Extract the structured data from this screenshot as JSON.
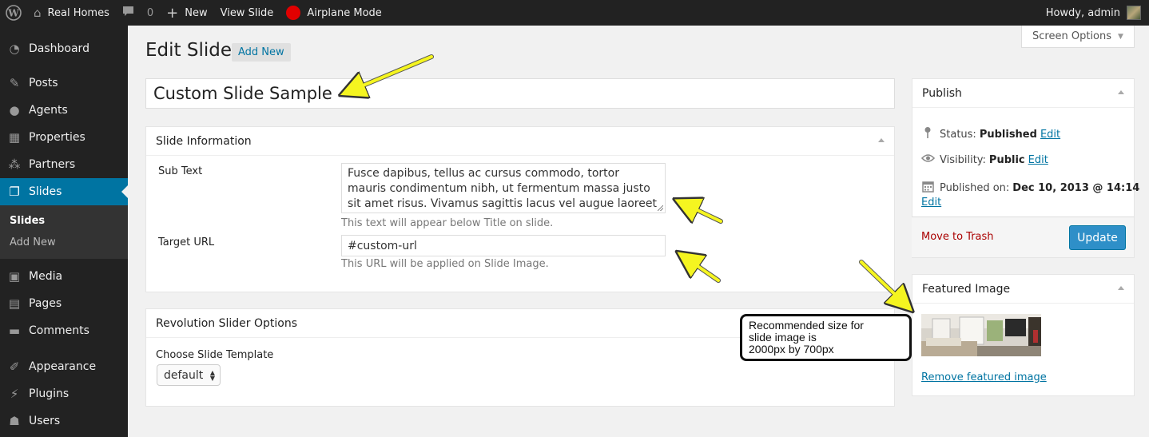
{
  "admin_bar": {
    "site_name": "Real Homes",
    "comments_count": "0",
    "new_label": "New",
    "view_label": "View Slide",
    "airplane_label": "Airplane Mode",
    "greeting": "Howdy, admin"
  },
  "sidebar": {
    "items": [
      {
        "label": "Dashboard",
        "icon": "dashboard-icon"
      },
      {
        "label": "Posts",
        "icon": "pin-icon"
      },
      {
        "label": "Agents",
        "icon": "users-icon"
      },
      {
        "label": "Properties",
        "icon": "building-icon"
      },
      {
        "label": "Partners",
        "icon": "groups-icon"
      },
      {
        "label": "Slides",
        "icon": "slides-icon"
      },
      {
        "label": "Media",
        "icon": "media-icon"
      },
      {
        "label": "Pages",
        "icon": "page-icon"
      },
      {
        "label": "Comments",
        "icon": "comment-icon"
      },
      {
        "label": "Appearance",
        "icon": "brush-icon"
      },
      {
        "label": "Plugins",
        "icon": "plug-icon"
      },
      {
        "label": "Users",
        "icon": "user-icon"
      }
    ],
    "submenu": [
      "Slides",
      "Add New"
    ],
    "accent": "#0074a2"
  },
  "header": {
    "screen_options": "Screen Options",
    "page_title": "Edit Slide",
    "add_new": "Add New"
  },
  "post": {
    "title": "Custom Slide Sample"
  },
  "slide_info": {
    "heading": "Slide Information",
    "sub_text_label": "Sub Text",
    "sub_text_value": "Fusce dapibus, tellus ac cursus commodo, tortor mauris condimentum nibh, ut fermentum massa justo sit amet risus. Vivamus sagittis lacus vel augue laoreet rutrum",
    "sub_text_desc": "This text will appear below Title on slide.",
    "url_label": "Target URL",
    "url_value": "#custom-url",
    "url_desc": "This URL will be applied on Slide Image."
  },
  "revolution": {
    "heading": "Revolution Slider Options",
    "template_label": "Choose Slide Template",
    "template_value": "default"
  },
  "publish": {
    "heading": "Publish",
    "status_label": "Status:",
    "status_value": "Published",
    "visibility_label": "Visibility:",
    "visibility_value": "Public",
    "published_label": "Published on:",
    "published_value": "Dec 10, 2013 @ 14:14",
    "edit": "Edit",
    "trash": "Move to Trash",
    "update": "Update"
  },
  "featured": {
    "heading": "Featured Image",
    "remove": "Remove featured image"
  },
  "callout": {
    "line1": "Recommended size for",
    "line2": "slide image is",
    "line3": "2000px by 700px"
  },
  "colors": {
    "arrow": "#f5f520",
    "admin_bar": "#222222",
    "update_button": "#2e8fc8",
    "trash_link": "#aa0000"
  }
}
